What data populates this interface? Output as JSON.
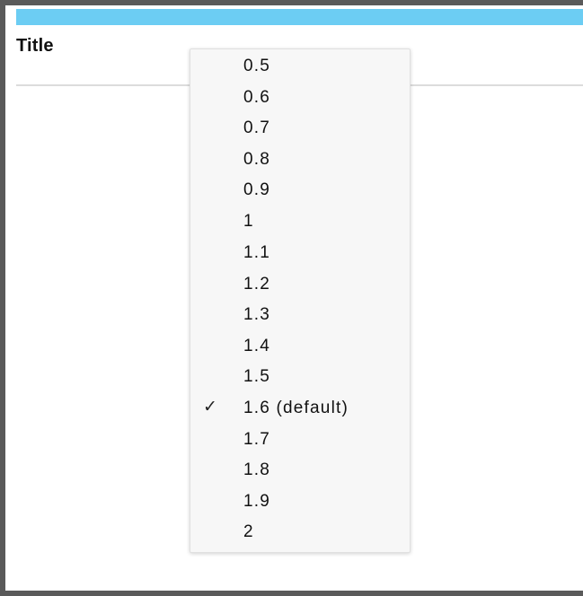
{
  "header": {
    "title_label": "Title"
  },
  "dropdown": {
    "items": [
      {
        "label": "0.5",
        "checked": false
      },
      {
        "label": "0.6",
        "checked": false
      },
      {
        "label": "0.7",
        "checked": false
      },
      {
        "label": "0.8",
        "checked": false
      },
      {
        "label": "0.9",
        "checked": false
      },
      {
        "label": "1",
        "checked": false
      },
      {
        "label": "1.1",
        "checked": false
      },
      {
        "label": "1.2",
        "checked": false
      },
      {
        "label": "1.3",
        "checked": false
      },
      {
        "label": "1.4",
        "checked": false
      },
      {
        "label": "1.5",
        "checked": false
      },
      {
        "label": "1.6 (default)",
        "checked": true
      },
      {
        "label": "1.7",
        "checked": false
      },
      {
        "label": "1.8",
        "checked": false
      },
      {
        "label": "1.9",
        "checked": false
      },
      {
        "label": "2",
        "checked": false
      }
    ],
    "check_glyph": "✓"
  },
  "colors": {
    "title_bar": "#6ccdf3",
    "frame": "#5a5a5a",
    "menu_background": "#f7f7f7"
  }
}
